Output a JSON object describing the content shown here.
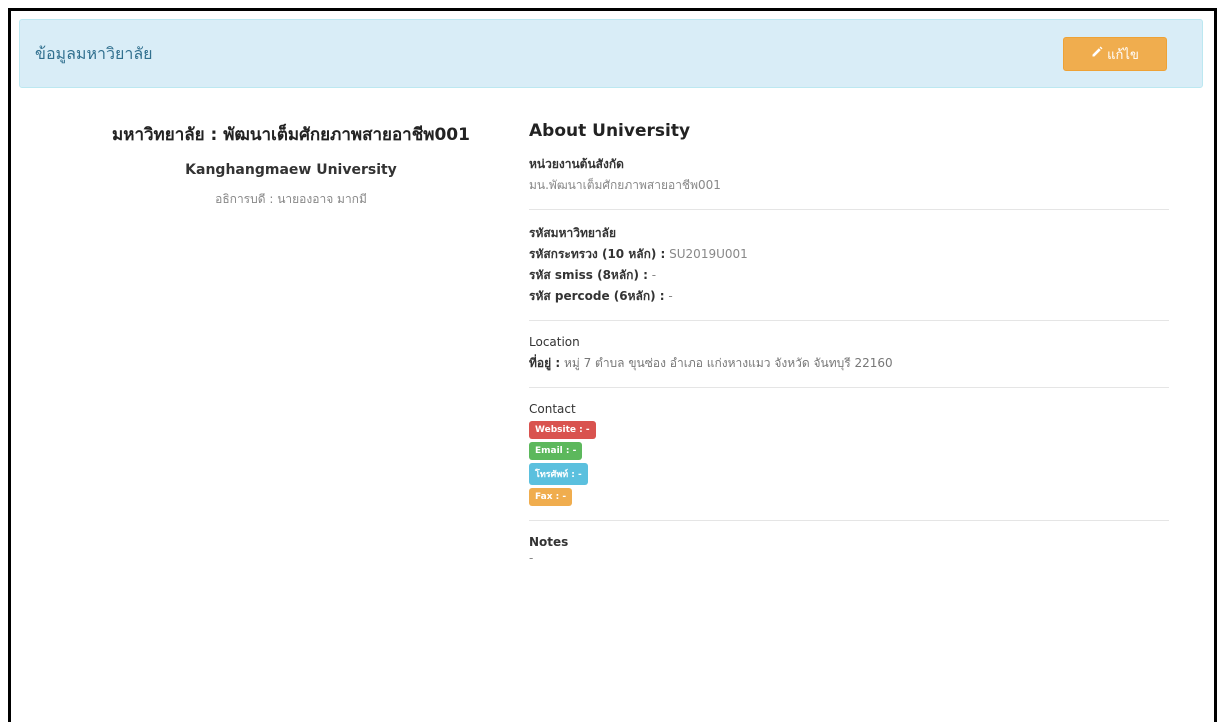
{
  "header": {
    "title": "ข้อมูลมหาวิยาลัย",
    "edit_label": "แก้ไข"
  },
  "profile": {
    "title": "มหาวิทยาลัย : พัฒนาเต็มศักยภาพสายอาชีพ001",
    "english_name": "Kanghangmaew University",
    "rector": "อธิการบดี : นายองอาจ มากมี"
  },
  "about": {
    "title": "About University",
    "affiliation": {
      "label": "หน่วยงานต้นสังกัด",
      "value": "มน.พัฒนาเต็มศักยภาพสายอาชีพ001"
    },
    "codes": {
      "label": "รหัสมหาวิทยาลัย",
      "ministry_key": "รหัสกระทรวง (10 หลัก) :",
      "ministry_value": " SU2019U001",
      "smiss_key": "รหัส smiss (8หลัก) :",
      "smiss_value": " -",
      "percode_key": "รหัส percode (6หลัก) :",
      "percode_value": " -"
    },
    "location": {
      "label": "Location",
      "address_key": "ที่อยู่ :",
      "address_value": " หมู่ 7 ตำบล ขุนซ่อง อำเภอ แก่งหางแมว จังหวัด จันทบุรี 22160"
    },
    "contact": {
      "label": "Contact",
      "website": "Website : -",
      "email": "Email : -",
      "phone": "โทรศัพท์ : -",
      "fax": "Fax : -",
      "colors": {
        "website": "#d9534f",
        "email": "#5cb85c",
        "phone": "#5bc0de",
        "fax": "#f0ad4e"
      }
    },
    "notes": {
      "label": "Notes",
      "value": "-"
    }
  },
  "icons": {
    "edit": "pencil-icon"
  }
}
